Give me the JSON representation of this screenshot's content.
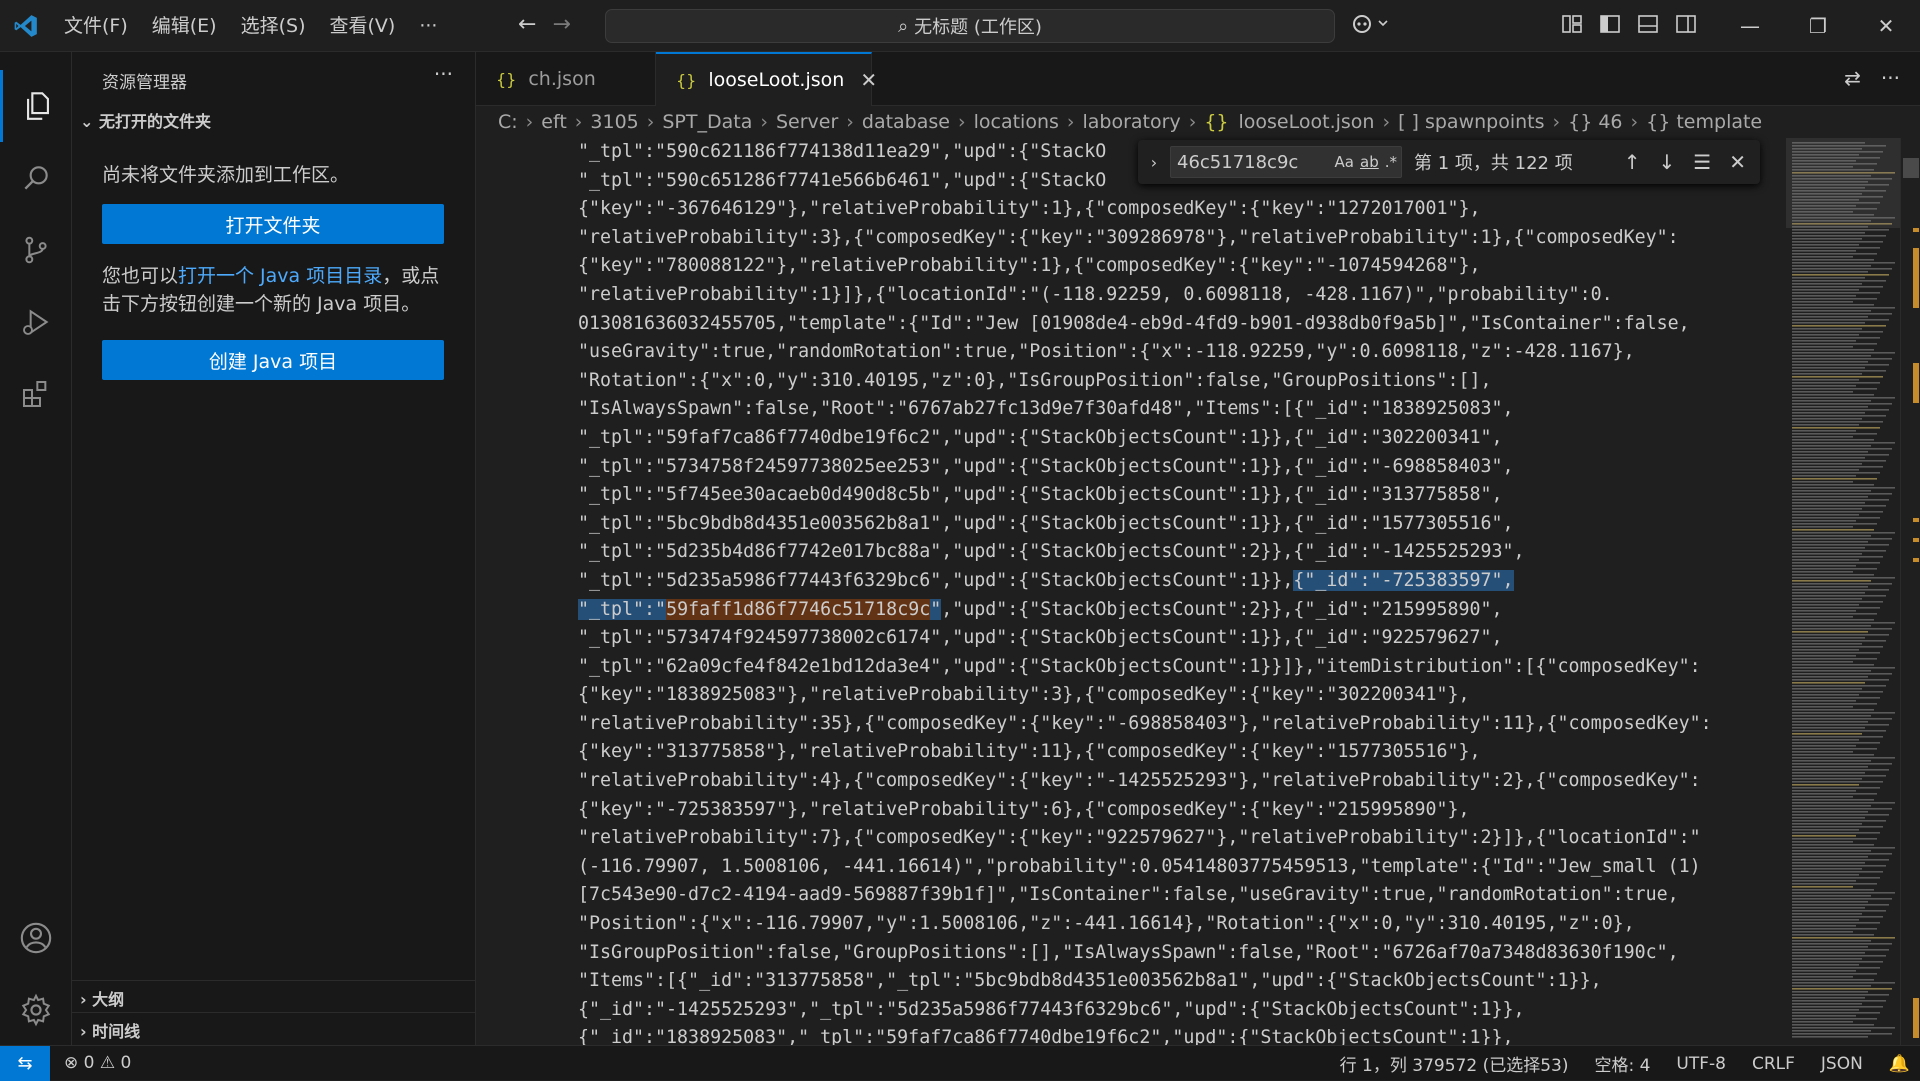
{
  "menu": [
    "文件(F)",
    "编辑(E)",
    "选择(S)",
    "查看(V)",
    "···"
  ],
  "command_center": "无标题 (工作区)",
  "sidebar": {
    "title": "资源管理器",
    "more": "···",
    "section": "无打开的文件夹",
    "no_folder_text": "尚未将文件夹添加到工作区。",
    "open_folder_button": "打开文件夹",
    "java_text_pre": "您也可以",
    "java_link": "打开一个 Java 项目目录",
    "java_text_post": "，或点击下方按钮创建一个新的 Java 项目。",
    "create_java_button": "创建 Java 项目",
    "outline": "大纲",
    "timeline": "时间线"
  },
  "tabs": [
    {
      "icon": "{}",
      "label": "ch.json"
    },
    {
      "icon": "{}",
      "label": "looseLoot.json",
      "close": "✕"
    }
  ],
  "breadcrumb": [
    "C:",
    "eft",
    "3105",
    "SPT_Data",
    "Server",
    "database",
    "locations",
    "laboratory",
    "looseLoot.json",
    "[ ] spawnpoints",
    "{} 46",
    "{} template"
  ],
  "find": {
    "query": "46c51718c9c",
    "opt_case": "Aa",
    "opt_word": "ab",
    "opt_regex": ".*",
    "result": "第 1 项，共 122 项"
  },
  "code_lines": [
    "\"_tpl\":\"590c621186f774138d11ea29\",\"upd\":{\"StackO",
    "\"_tpl\":\"590c651286f7741e566b6461\",\"upd\":{\"StackO",
    "{\"key\":\"-367646129\"},\"relativeProbability\":1},{\"composedKey\":{\"key\":\"1272017001\"},",
    "\"relativeProbability\":3},{\"composedKey\":{\"key\":\"309286978\"},\"relativeProbability\":1},{\"composedKey\":",
    "{\"key\":\"780088122\"},\"relativeProbability\":1},{\"composedKey\":{\"key\":\"-1074594268\"},",
    "\"relativeProbability\":1}]},{\"locationId\":\"(-118.92259, 0.6098118, -428.1167)\",\"probability\":0.",
    "013081636032455705,\"template\":{\"Id\":\"Jew [01908de4-eb9d-4fd9-b901-d938db0f9a5b]\",\"IsContainer\":false,",
    "\"useGravity\":true,\"randomRotation\":true,\"Position\":{\"x\":-118.92259,\"y\":0.6098118,\"z\":-428.1167},",
    "\"Rotation\":{\"x\":0,\"y\":310.40195,\"z\":0},\"IsGroupPosition\":false,\"GroupPositions\":[],",
    "\"IsAlwaysSpawn\":false,\"Root\":\"6767ab27fc13d9e7f30afd48\",\"Items\":[{\"_id\":\"1838925083\",",
    "\"_tpl\":\"59faf7ca86f7740dbe19f6c2\",\"upd\":{\"StackObjectsCount\":1}},{\"_id\":\"302200341\",",
    "\"_tpl\":\"5734758f24597738025ee253\",\"upd\":{\"StackObjectsCount\":1}},{\"_id\":\"-698858403\",",
    "\"_tpl\":\"5f745ee30acaeb0d490d8c5b\",\"upd\":{\"StackObjectsCount\":1}},{\"_id\":\"313775858\",",
    "\"_tpl\":\"5bc9bdb8d4351e003562b8a1\",\"upd\":{\"StackObjectsCount\":1}},{\"_id\":\"1577305516\",",
    "\"_tpl\":\"5d235b4d86f7742e017bc88a\",\"upd\":{\"StackObjectsCount\":2}},{\"_id\":\"-1425525293\",",
    "\"_tpl\":\"5d235a5986f77443f6329bc6\",\"upd\":{\"StackObjectsCount\":1}},",
    "\"_tpl\":\"",
    "\"_tpl\":\"573474f924597738002c6174\",\"upd\":{\"StackObjectsCount\":1}},{\"_id\":\"922579627\",",
    "\"_tpl\":\"62a09cfe4f842e1bd12da3e4\",\"upd\":{\"StackObjectsCount\":1}}]},\"itemDistribution\":[{\"composedKey\":",
    "{\"key\":\"1838925083\"},\"relativeProbability\":3},{\"composedKey\":{\"key\":\"302200341\"},",
    "\"relativeProbability\":35},{\"composedKey\":{\"key\":\"-698858403\"},\"relativeProbability\":11},{\"composedKey\":",
    "{\"key\":\"313775858\"},\"relativeProbability\":11},{\"composedKey\":{\"key\":\"1577305516\"},",
    "\"relativeProbability\":4},{\"composedKey\":{\"key\":\"-1425525293\"},\"relativeProbability\":2},{\"composedKey\":",
    "{\"key\":\"-725383597\"},\"relativeProbability\":6},{\"composedKey\":{\"key\":\"215995890\"},",
    "\"relativeProbability\":7},{\"composedKey\":{\"key\":\"922579627\"},\"relativeProbability\":2}]},{\"locationId\":\"",
    "(-116.79907, 1.5008106, -441.16614)\",\"probability\":0.05414803775459513,\"template\":{\"Id\":\"Jew_small (1)",
    "[7c543e90-d7c2-4194-aad9-569887f39b1f]\",\"IsContainer\":false,\"useGravity\":true,\"randomRotation\":true,",
    "\"Position\":{\"x\":-116.79907,\"y\":1.5008106,\"z\":-441.16614},\"Rotation\":{\"x\":0,\"y\":310.40195,\"z\":0},",
    "\"IsGroupPosition\":false,\"GroupPositions\":[],\"IsAlwaysSpawn\":false,\"Root\":\"6726af70a7348d83630f190c\",",
    "\"Items\":[{\"_id\":\"313775858\",\"_tpl\":\"5bc9bdb8d4351e003562b8a1\",\"upd\":{\"StackObjectsCount\":1}},",
    "{\"_id\":\"-1425525293\",\"_tpl\":\"5d235a5986f77443f6329bc6\",\"upd\":{\"StackObjectsCount\":1}},",
    "{\"_id\":\"1838925083\",\"_tpl\":\"59faf7ca86f7740dbe19f6c2\",\"upd\":{\"StackObjectsCount\":1}},"
  ],
  "highlight": {
    "line16_sel": "{\"_id\":\"-725383597\",",
    "line17_find": "59faff1d86f7746c51718c9c",
    "line17_sel_after": "\"",
    "line17_rest": ",\"upd\":{\"StackObjectsCount\":2}},{\"_id\":\"215995890\","
  },
  "status": {
    "remote": "⇆",
    "problems": "⊗ 0 ⚠ 0",
    "position": "行 1，列 379572 (已选择53)",
    "spaces": "空格: 4",
    "encoding": "UTF-8",
    "crlf": "CRLF",
    "lang": "JSON"
  },
  "colors": {
    "accent": "#0078d4",
    "link": "#4daafc",
    "json_icon": "#cbcb41"
  }
}
